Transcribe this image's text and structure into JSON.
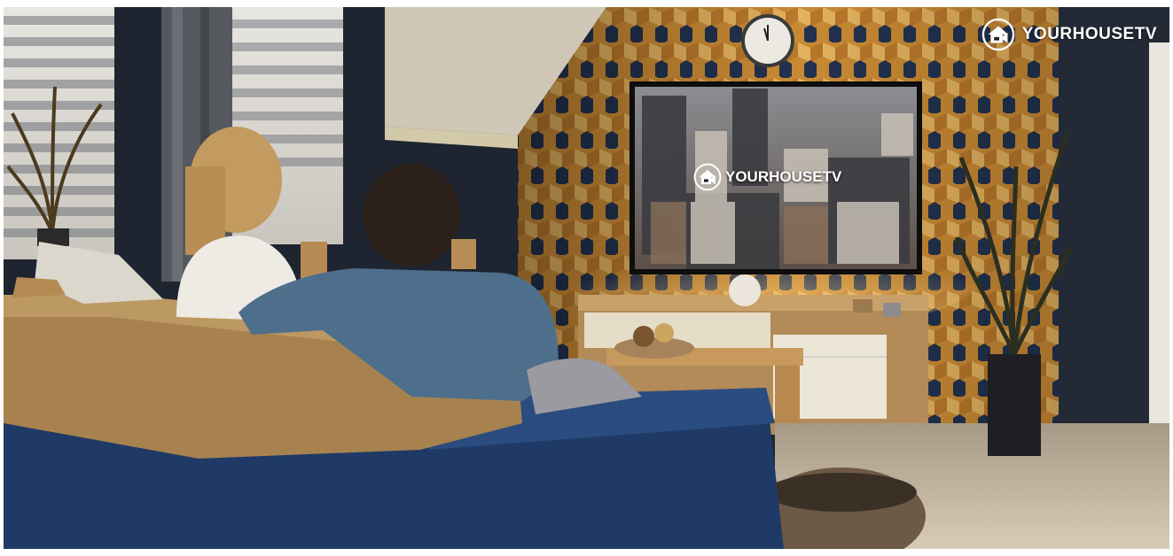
{
  "watermark": {
    "icon": "house-camera-logo-icon",
    "text": "YOURHOUSETV"
  },
  "tv_overlay": {
    "icon": "house-camera-logo-icon",
    "text": "YOURHOUSETV"
  },
  "colors": {
    "wall_dark": "#1f2530",
    "wallpaper_orange": "#d89a3f",
    "wallpaper_navy": "#1e2d48",
    "sofa_blue": "#1f3a66",
    "throw_blanket": "#a7824f",
    "tv_bezel": "#0d0d0d",
    "floor": "#c4b7a1",
    "brand_white": "#ffffff"
  }
}
